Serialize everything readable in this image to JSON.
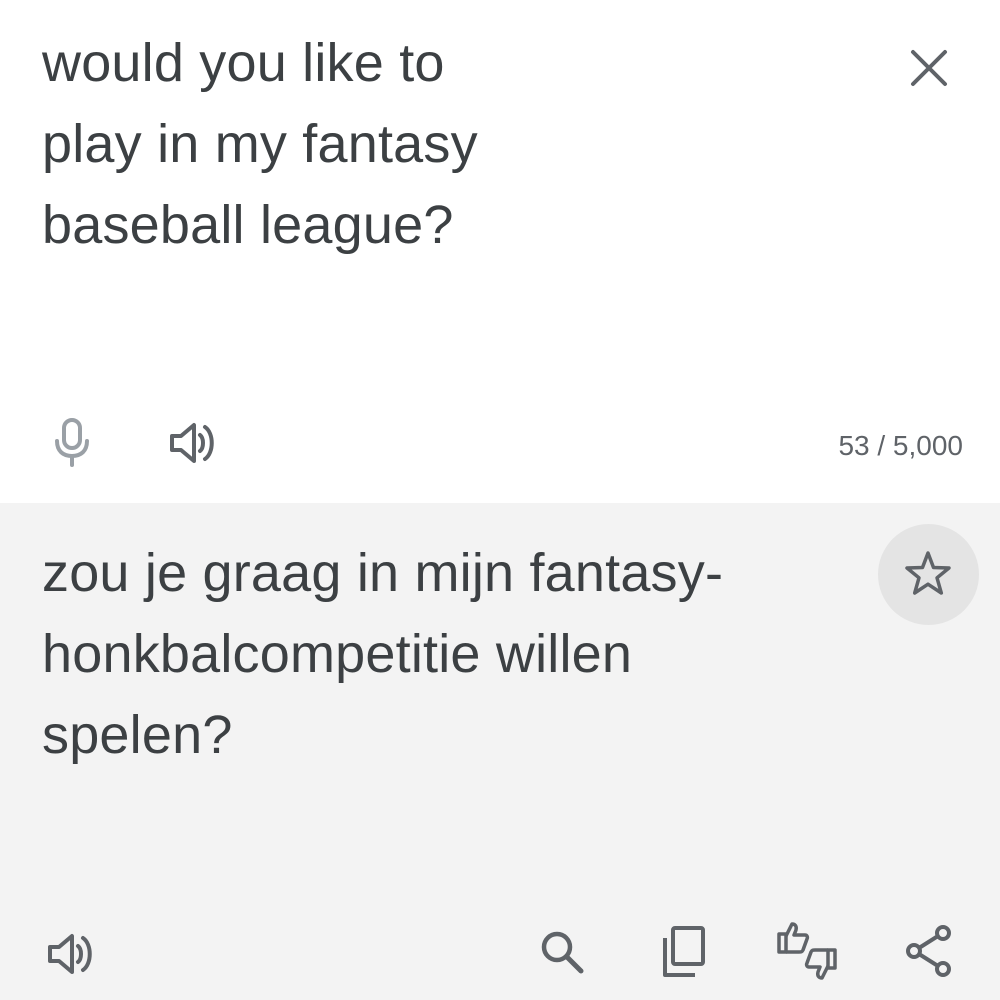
{
  "source": {
    "text": "would you like to\nplay in my fantasy\nbaseball league?",
    "char_counter": "53 / 5,000",
    "icons": {
      "close": "close-icon",
      "mic": "mic-icon",
      "speaker": "speaker-icon"
    }
  },
  "translation": {
    "text": "zou je graag in mijn fantasy-\nhonkbalcompetitie willen\nspelen?",
    "icons": {
      "star": "star-icon",
      "speaker": "speaker-icon",
      "search": "search-icon",
      "copy": "copy-icon",
      "feedback": "thumbs-feedback-icon",
      "share": "share-icon"
    }
  },
  "colors": {
    "text": "#3c4043",
    "icon": "#5f6368",
    "icon_disabled": "#9aa0a6",
    "target_bg": "#f3f3f3",
    "star_circle_bg": "#e4e4e4"
  }
}
